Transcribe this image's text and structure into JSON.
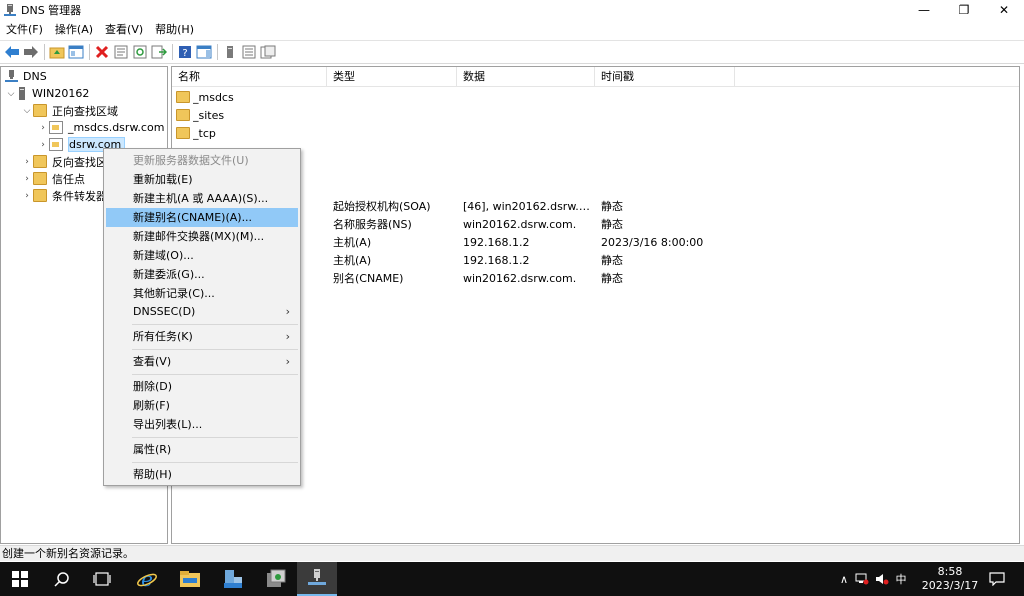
{
  "window": {
    "title": "DNS 管理器",
    "minimize": "—",
    "restore": "❐",
    "close": "✕"
  },
  "menubar": [
    "文件(F)",
    "操作(A)",
    "查看(V)",
    "帮助(H)"
  ],
  "tree": {
    "root": "DNS",
    "server": "WIN20162",
    "forward_zones": "正向查找区域",
    "msdcs_zone": "_msdcs.dsrw.com",
    "selected_zone": "dsrw.com",
    "reverse_zones": "反向查找区域",
    "trust_points": "信任点",
    "conditional_forwarders": "条件转发器"
  },
  "list": {
    "columns": [
      "名称",
      "类型",
      "数据",
      "时间戳"
    ],
    "folders": [
      "_msdcs",
      "_sites",
      "_tcp"
    ],
    "records": [
      {
        "type": "起始授权机构(SOA)",
        "data": "[46], win20162.dsrw.co...",
        "timestamp": "静态"
      },
      {
        "type": "名称服务器(NS)",
        "data": "win20162.dsrw.com.",
        "timestamp": "静态"
      },
      {
        "type": "主机(A)",
        "data": "192.168.1.2",
        "timestamp": "2023/3/16 8:00:00"
      },
      {
        "type": "主机(A)",
        "data": "192.168.1.2",
        "timestamp": "静态"
      },
      {
        "type": "别名(CNAME)",
        "data": "win20162.dsrw.com.",
        "timestamp": "静态"
      }
    ]
  },
  "context_menu": {
    "items": [
      {
        "label": "更新服务器数据文件(U)",
        "state": "disabled"
      },
      {
        "label": "重新加载(E)"
      },
      {
        "label": "新建主机(A 或 AAAA)(S)..."
      },
      {
        "label": "新建别名(CNAME)(A)...",
        "state": "highlighted"
      },
      {
        "label": "新建邮件交换器(MX)(M)..."
      },
      {
        "label": "新建域(O)..."
      },
      {
        "label": "新建委派(G)..."
      },
      {
        "label": "其他新记录(C)..."
      },
      {
        "label": "DNSSEC(D)",
        "submenu": true
      },
      {
        "label": "所有任务(K)",
        "submenu": true
      },
      {
        "label": "查看(V)",
        "submenu": true
      },
      {
        "label": "删除(D)"
      },
      {
        "label": "刷新(F)"
      },
      {
        "label": "导出列表(L)..."
      },
      {
        "label": "属性(R)"
      },
      {
        "label": "帮助(H)"
      }
    ],
    "submenu_arrow": "›"
  },
  "statusbar": {
    "text": "创建一个新别名资源记录。"
  },
  "taskbar": {
    "ime": "中",
    "time": "8:58",
    "date": "2023/3/17",
    "tray_chevron": "∧"
  },
  "colors": {
    "highlight": "#91c9f7",
    "selection": "#cce8ff",
    "taskbar": "#101010",
    "folder": "#f0c65a"
  }
}
